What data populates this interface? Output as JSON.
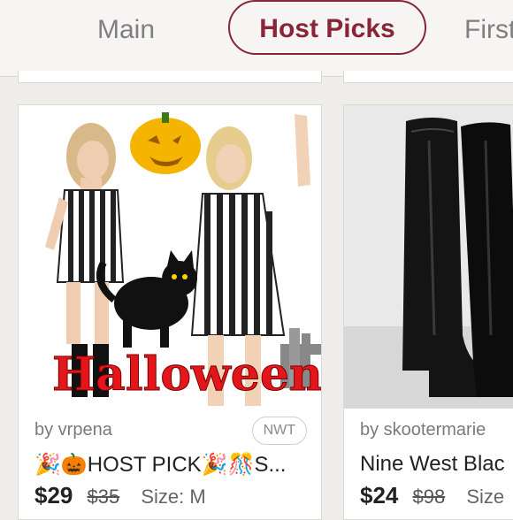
{
  "tabs": [
    {
      "label": "Main"
    },
    {
      "label": "Host Picks",
      "active": true
    },
    {
      "label": "First"
    }
  ],
  "listings": [
    {
      "seller": "by vrpena",
      "badge": "NWT",
      "title": "🎉🎃HOST PICK🎉🎊S...",
      "price": "$29",
      "original_price": "$35",
      "size": "Size: M",
      "image_text": "Halloween"
    },
    {
      "seller": "by skootermarie",
      "title": "Nine West Blac",
      "price": "$24",
      "original_price": "$98",
      "size": "Size"
    }
  ],
  "colors": {
    "accent": "#8a2438",
    "background": "#efedea"
  }
}
